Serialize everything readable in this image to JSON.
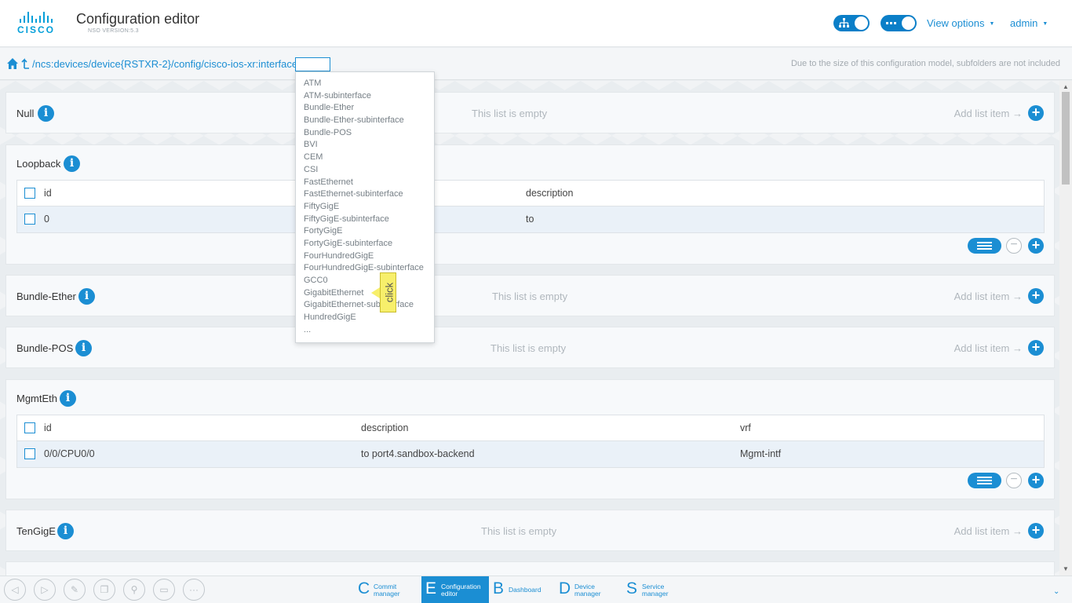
{
  "header": {
    "logo_text": "CISCO",
    "title": "Configuration editor",
    "version": "NSO VERSION:5.3",
    "view_options": "View options",
    "user": "admin",
    "caret": "▼",
    "accent": "#1b8ed3"
  },
  "pathbar": {
    "path": "/ncs:devices/device{RSTXR-2}/config/cisco-ios-xr:interface/",
    "input_value": "",
    "notice": "Due to the size of this configuration model, subfolders are not included"
  },
  "common": {
    "empty": "This list is empty",
    "add_item": "Add list item",
    "add_arrow": "→",
    "info": "i"
  },
  "panels": {
    "null": {
      "title": "Null"
    },
    "loopback": {
      "title": "Loopback",
      "headers": [
        "id",
        "description"
      ],
      "rows": [
        [
          "0",
          "to"
        ]
      ]
    },
    "bundle_ether": {
      "title": "Bundle-Ether"
    },
    "bundle_pos": {
      "title": "Bundle-POS"
    },
    "mgmteth": {
      "title": "MgmtEth",
      "headers": [
        "id",
        "description",
        "vrf"
      ],
      "rows": [
        [
          "0/0/CPU0/0",
          "to port4.sandbox-backend",
          "Mgmt-intf"
        ]
      ]
    },
    "tengige": {
      "title": "TenGigE"
    }
  },
  "dropdown": {
    "items": [
      "ATM",
      "ATM-subinterface",
      "Bundle-Ether",
      "Bundle-Ether-subinterface",
      "Bundle-POS",
      "BVI",
      "CEM",
      "CSI",
      "FastEthernet",
      "FastEthernet-subinterface",
      "FiftyGigE",
      "FiftyGigE-subinterface",
      "FortyGigE",
      "FortyGigE-subinterface",
      "FourHundredGigE",
      "FourHundredGigE-subinterface",
      "GCC0",
      "GigabitEthernet",
      "GigabitEthernet-subinterface",
      "HundredGigE",
      "..."
    ]
  },
  "click_tag": "click",
  "bottom_nav": [
    {
      "letter": "C",
      "line1": "Commit",
      "line2": "manager"
    },
    {
      "letter": "E",
      "line1": "Configuration",
      "line2": "editor"
    },
    {
      "letter": "B",
      "line1": "Dashboard",
      "line2": ""
    },
    {
      "letter": "D",
      "line1": "Device",
      "line2": "manager"
    },
    {
      "letter": "S",
      "line1": "Service",
      "line2": "manager"
    }
  ]
}
